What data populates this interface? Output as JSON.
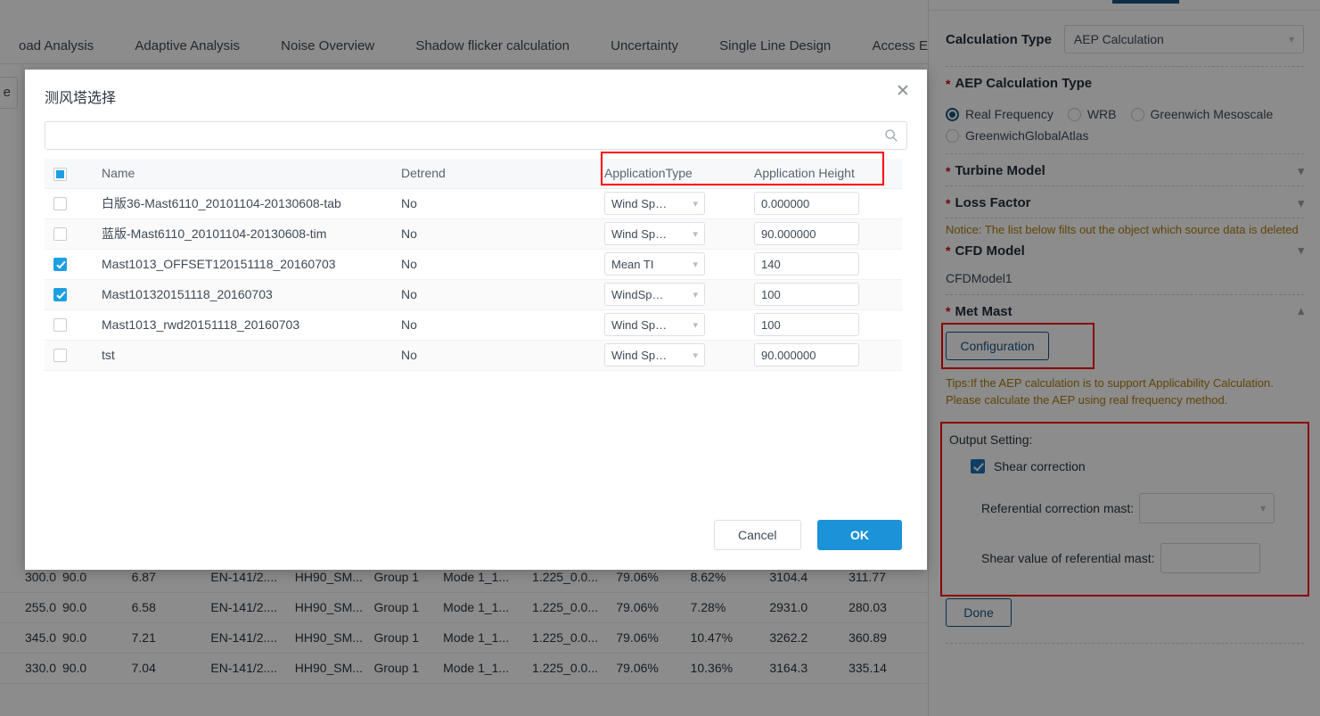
{
  "background": {
    "tabs": [
      {
        "label": "oad Analysis"
      },
      {
        "label": "Adaptive Analysis"
      },
      {
        "label": "Noise Overview"
      },
      {
        "label": "Shadow flicker calculation"
      },
      {
        "label": "Uncertainty"
      },
      {
        "label": "Single Line Design"
      },
      {
        "label": "Access Econom"
      }
    ],
    "side_button_label": "e",
    "data_table": {
      "rows": [
        [
          "300.0",
          "90.0",
          "6.87",
          "EN-141/2....",
          "HH90_SM...",
          "Group 1",
          "Mode 1_1...",
          "1.225_0.0...",
          "79.06%",
          "8.62%",
          "3104.4",
          "311.77"
        ],
        [
          "255.0",
          "90.0",
          "6.58",
          "EN-141/2....",
          "HH90_SM...",
          "Group 1",
          "Mode 1_1...",
          "1.225_0.0...",
          "79.06%",
          "7.28%",
          "2931.0",
          "280.03"
        ],
        [
          "345.0",
          "90.0",
          "7.21",
          "EN-141/2....",
          "HH90_SM...",
          "Group 1",
          "Mode 1_1...",
          "1.225_0.0...",
          "79.06%",
          "10.47%",
          "3262.2",
          "360.89"
        ],
        [
          "330.0",
          "90.0",
          "7.04",
          "EN-141/2....",
          "HH90_SM...",
          "Group 1",
          "Mode 1_1...",
          "1.225_0.0...",
          "79.06%",
          "10.36%",
          "3164.3",
          "335.14"
        ]
      ]
    }
  },
  "dialog": {
    "title": "测风塔选择",
    "close_icon": "close-icon",
    "search": {
      "value": "",
      "placeholder": "",
      "icon": "search-icon"
    },
    "columns": {
      "name": "Name",
      "detrend": "Detrend",
      "application_type": "ApplicationType",
      "application_height": "Application Height"
    },
    "select_all_state": "indeterminate",
    "rows": [
      {
        "checked": false,
        "name": "白版36-Mast6110_20101104-20130608-tab",
        "detrend": "No",
        "app_type": "Wind Sp…",
        "app_height": "0.000000"
      },
      {
        "checked": false,
        "name": "蓝版-Mast6110_20101104-20130608-tim",
        "detrend": "No",
        "app_type": "Wind Sp…",
        "app_height": "90.000000"
      },
      {
        "checked": true,
        "name": "Mast1013_OFFSET120151118_20160703",
        "detrend": "No",
        "app_type": "Mean TI",
        "app_height": "140"
      },
      {
        "checked": true,
        "name": "Mast101320151118_20160703",
        "detrend": "No",
        "app_type": "WindSp…",
        "app_height": "100"
      },
      {
        "checked": false,
        "name": "Mast1013_rwd20151118_20160703",
        "detrend": "No",
        "app_type": "Wind Sp…",
        "app_height": "100"
      },
      {
        "checked": false,
        "name": "tst",
        "detrend": "No",
        "app_type": "Wind Sp…",
        "app_height": "90.000000"
      }
    ],
    "cancel_label": "Cancel",
    "ok_label": "OK"
  },
  "panel": {
    "calculation_type": {
      "label": "Calculation Type",
      "value": "AEP Calculation"
    },
    "aep_calculation_type": {
      "title": "AEP Calculation Type",
      "required": "*",
      "options": [
        {
          "label": "Real Frequency",
          "selected": true
        },
        {
          "label": "WRB",
          "selected": false
        },
        {
          "label": "Greenwich Mesoscale",
          "selected": false
        },
        {
          "label": "GreenwichGlobalAtlas",
          "selected": false
        }
      ]
    },
    "turbine_model": {
      "title": "Turbine Model",
      "required": "*"
    },
    "loss_factor": {
      "title": "Loss Factor",
      "required": "*"
    },
    "notice": "Notice: The list below filts out the object which source data is deleted",
    "cfd_model": {
      "title": "CFD Model",
      "required": "*",
      "value": "CFDModel1"
    },
    "met_mast": {
      "title": "Met Mast",
      "required": "*",
      "configuration_label": "Configuration",
      "tips": "Tips:If the AEP calculation is to support Applicability Calculation. Please calculate the AEP using real frequency method."
    },
    "output_setting": {
      "title": "Output Setting:",
      "shear_correction": {
        "label": "Shear correction",
        "checked": true
      },
      "referential_correction_mast": {
        "label": "Referential correction mast:",
        "value": ""
      },
      "shear_value_of_referential_mast": {
        "label": "Shear value of referential mast:",
        "value": ""
      }
    },
    "done_label": "Done",
    "accent_color": "#1b5480",
    "highlight_color": "#ff0000",
    "warning_color": "#b07d0d"
  }
}
